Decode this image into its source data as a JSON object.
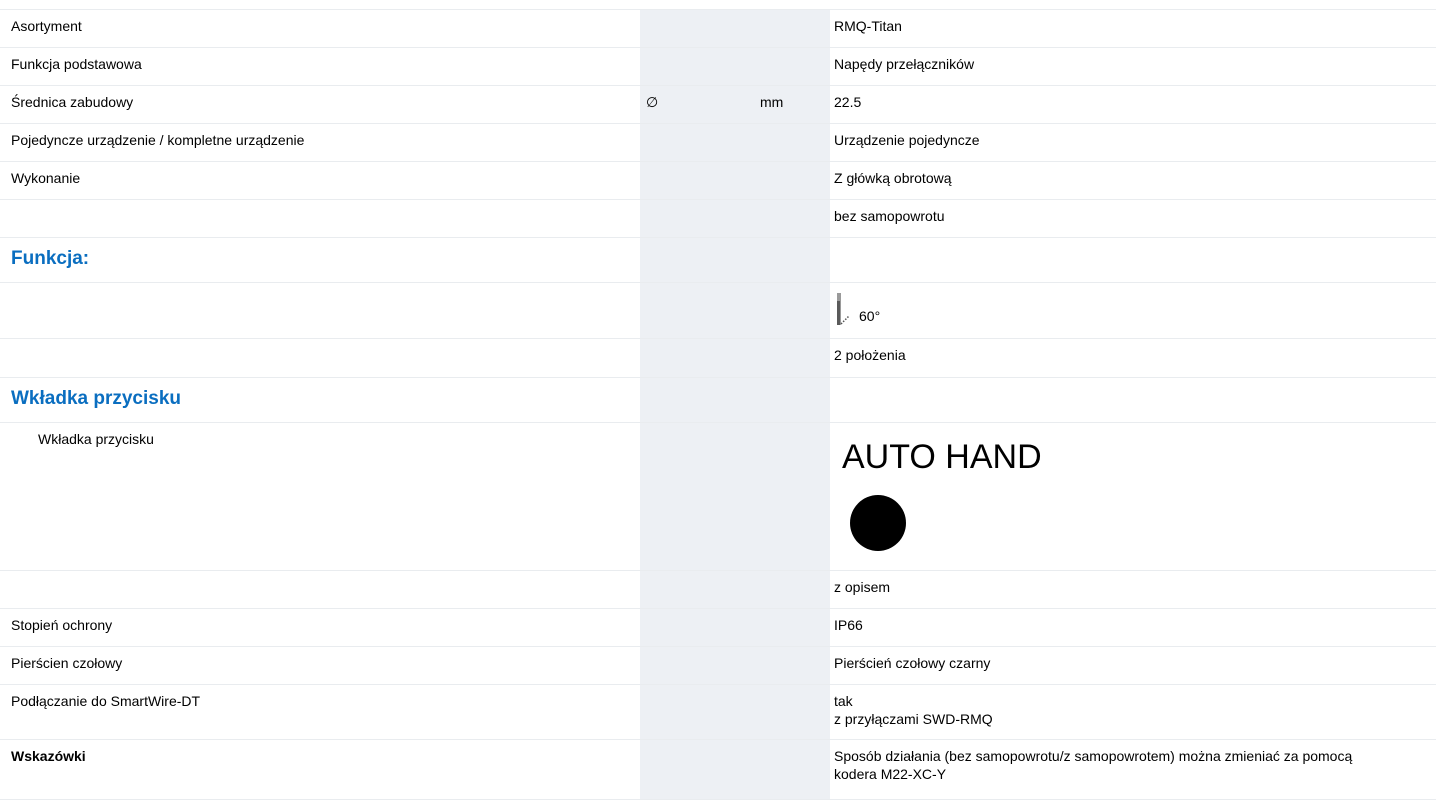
{
  "colors": {
    "section_heading": "#0a6ec0",
    "unit_column_bg": "#edf0f4",
    "row_border": "#e9ecef"
  },
  "rows": {
    "asortyment": {
      "label": "Asortyment",
      "value": "RMQ-Titan"
    },
    "funkcja_podstawowa": {
      "label": "Funkcja podstawowa",
      "value": "Napędy przełączników"
    },
    "srednica": {
      "label": "Średnica zabudowy",
      "symbol": "∅",
      "unit": "mm",
      "value": "22.5"
    },
    "pojedyncze": {
      "label": "Pojedyncze urządzenie / kompletne urządzenie",
      "value": "Urządzenie pojedyncze"
    },
    "wykonanie": {
      "label": "Wykonanie",
      "value": "Z główką obrotową"
    },
    "wykonanie2": {
      "value": "bez samopowrotu"
    },
    "funkcja_heading": {
      "label": "Funkcja:"
    },
    "kat": {
      "value": "60°",
      "icon": "rotation-angle-icon"
    },
    "polozenia": {
      "value": "2 położenia"
    },
    "wkladka_heading": {
      "label": "Wkładka przycisku"
    },
    "wkladka": {
      "label": "Wkładka przycisku",
      "text": "AUTO HAND",
      "icon": "filled-circle-icon"
    },
    "opis": {
      "value": "z opisem"
    },
    "ochrona": {
      "label": "Stopień ochrony",
      "value": "IP66"
    },
    "pierscien": {
      "label": "Pierścien czołowy",
      "value": "Pierścień czołowy czarny"
    },
    "smartwire": {
      "label": "Podłączanie do SmartWire-DT",
      "value_line1": "tak",
      "value_line2": "z przyłączami SWD-RMQ"
    },
    "wskazowki": {
      "label": "Wskazówki",
      "value_line1": "Sposób działania (bez samopowrotu/z samopowrotem) można zmieniać za pomocą",
      "value_line2": "kodera M22-XC-Y"
    }
  }
}
